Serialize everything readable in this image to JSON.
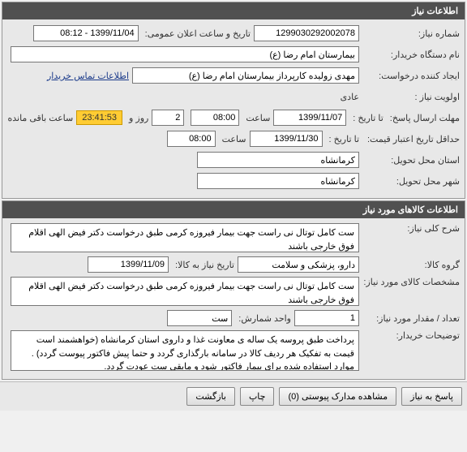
{
  "panel1": {
    "title": "اطلاعات نیاز",
    "need_number_label": "شماره نیاز:",
    "need_number": "1299030292002078",
    "announce_label": "تاریخ و ساعت اعلان عمومی:",
    "announce_value": "1399/11/04 - 08:12",
    "org_label": "نام دستگاه خریدار:",
    "org_value": "بیمارستان امام رضا (ع)",
    "creator_label": "ایجاد کننده درخواست:",
    "creator_value": "مهدی زولیده کارپرداز بیمارستان امام رضا (ع)",
    "contact_link": "اطلاعات تماس خریدار",
    "priority_label": "اولویت نیاز :",
    "priority_value": "عادی",
    "deadline_label": "مهلت ارسال پاسخ:",
    "to_date_label": "تا تاریخ :",
    "deadline_date": "1399/11/07",
    "time_label": "ساعت",
    "deadline_time": "08:00",
    "days_value": "2",
    "days_label": "روز و",
    "countdown": "23:41:53",
    "remain_label": "ساعت باقی مانده",
    "min_validity_label": "حداقل تاریخ اعتبار قیمت:",
    "min_validity_date": "1399/11/30",
    "min_validity_time": "08:00",
    "delivery_province_label": "استان محل تحویل:",
    "delivery_province": "کرمانشاه",
    "delivery_city_label": "شهر محل تحویل:",
    "delivery_city": "کرمانشاه"
  },
  "panel2": {
    "title": "اطلاعات کالاهای مورد نیاز",
    "desc_label": "شرح کلی نیاز:",
    "desc_value": "ست کامل توتال نی راست جهت بیمار فیروزه کرمی طبق درخواست دکتر فیض الهی اقلام فوق خارجی باشند",
    "group_label": "گروه کالا:",
    "group_value": "دارو، پزشکی و سلامت",
    "to_date_label": "تاریخ نیاز به کالا:",
    "to_date_value": "1399/11/09",
    "spec_label": "مشخصات کالای مورد نیاز:",
    "spec_value": "ست کامل توتال نی راست جهت بیمار فیروزه کرمی طبق درخواست دکتر فیض الهی اقلام فوق خارجی باشند",
    "qty_label": "تعداد / مقدار مورد نیاز:",
    "qty_value": "1",
    "unit_label": "واحد شمارش:",
    "unit_value": "ست",
    "notes_label": "توضیحات خریدار:",
    "notes_value": "پرداخت طبق پروسه یک ساله ی معاونت غذا و داروی استان کرمانشاه (خواهشمند است قیمت به تفکیک هر ردیف کالا در سامانه بارگذاری گردد و حتما پیش فاکتور پیوست گردد) . موارد استفاده شده برای بیمار فاکتور شود و مابقی ست عودت گردد."
  },
  "buttons": {
    "respond": "پاسخ به نیاز",
    "attachments": "مشاهده مدارک پیوستی (0)",
    "print": "چاپ",
    "back": "بازگشت"
  }
}
